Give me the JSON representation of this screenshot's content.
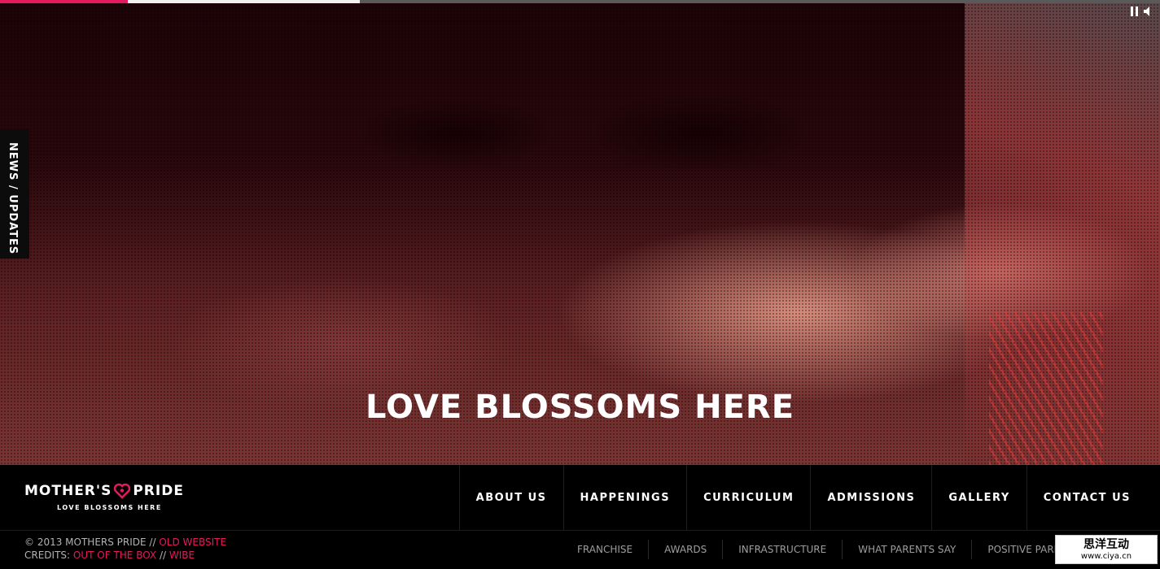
{
  "slider": {
    "progress_fraction": 0.31,
    "buffered_fraction": 0.11
  },
  "hero": {
    "tagline": "LOVE BLOSSOMS HERE"
  },
  "side_tab": {
    "label": "NEWS / UPDATES"
  },
  "media_controls": {
    "pause_icon": "pause-icon",
    "volume_icon": "volume-icon"
  },
  "brand": {
    "name_left": "MOTHER'S",
    "name_right": "PRIDE",
    "tagline": "LOVE BLOSSOMS HERE",
    "accent_color": "#e5195f"
  },
  "main_nav": {
    "items": [
      {
        "label": "ABOUT US"
      },
      {
        "label": "HAPPENINGS"
      },
      {
        "label": "CURRICULUM"
      },
      {
        "label": "ADMISSIONS"
      },
      {
        "label": "GALLERY"
      },
      {
        "label": "CONTACT US"
      }
    ]
  },
  "sub_nav": {
    "items": [
      {
        "label": "FRANCHISE"
      },
      {
        "label": "AWARDS"
      },
      {
        "label": "INFRASTRUCTURE"
      },
      {
        "label": "WHAT PARENTS SAY"
      },
      {
        "label": "POSITIVE PARENTING"
      }
    ]
  },
  "legal": {
    "copyright": "© 2013 MOTHERS PRIDE //",
    "old_website": "OLD WEBSITE",
    "credits_label": "CREDITS:",
    "credit_1": "OUT OF THE BOX",
    "separator": "//",
    "credit_2": "WIBE"
  },
  "watermark": {
    "name": "思洋互动",
    "url": "www.ciya.cn"
  }
}
